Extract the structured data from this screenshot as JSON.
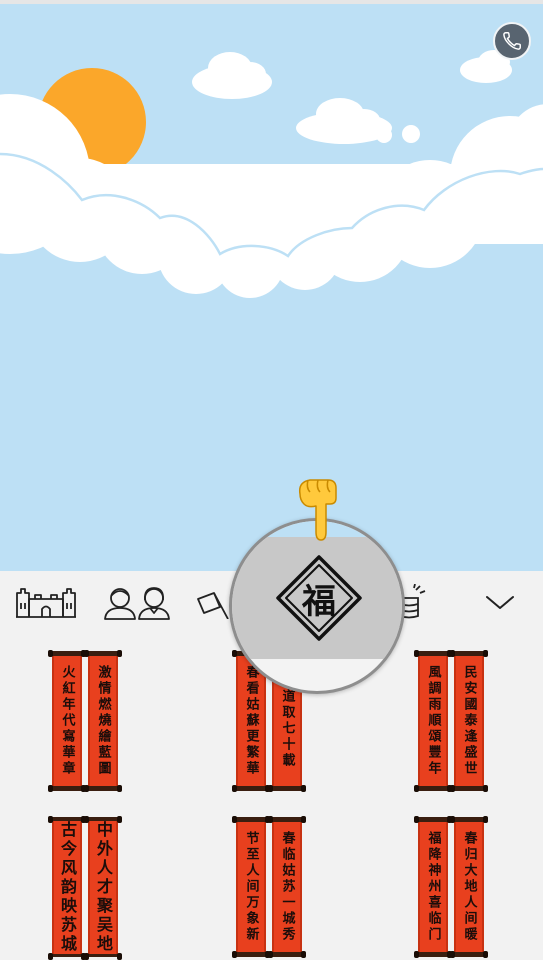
{
  "scene": {
    "sky_color": "#bde0f5",
    "sun_color": "#fba72a",
    "cloud_color": "#ffffff"
  },
  "call_button": {
    "icon": "phone-icon"
  },
  "toolbar": {
    "categories": [
      {
        "icon": "castle-icon"
      },
      {
        "icon": "couple-icon"
      },
      {
        "icon": "flag-icon"
      },
      {
        "icon": "fu-diamond-icon",
        "label": "福",
        "selected": true
      },
      {
        "icon": "coin-stack-icon"
      }
    ],
    "expand_icon": "chevron-down-icon"
  },
  "couplets": [
    {
      "left": "火紅年代寫華章",
      "right": "激情燃燒繪藍圖"
    },
    {
      "left": "春看姑蘇更繁華",
      "right": "開道取七十載"
    },
    {
      "left": "風調雨順頌豐年",
      "right": "民安國泰逢盛世"
    },
    {
      "left": "古今风韵映苏城",
      "right": "中外人才聚吴地"
    },
    {
      "left": "节至人间万象新",
      "right": "春临姑苏一城秀"
    },
    {
      "left": "福降神州喜临门",
      "right": "春归大地人间暖"
    }
  ],
  "colors": {
    "couplet_red": "#e8401e",
    "panel_bg": "#f2f2f2"
  }
}
